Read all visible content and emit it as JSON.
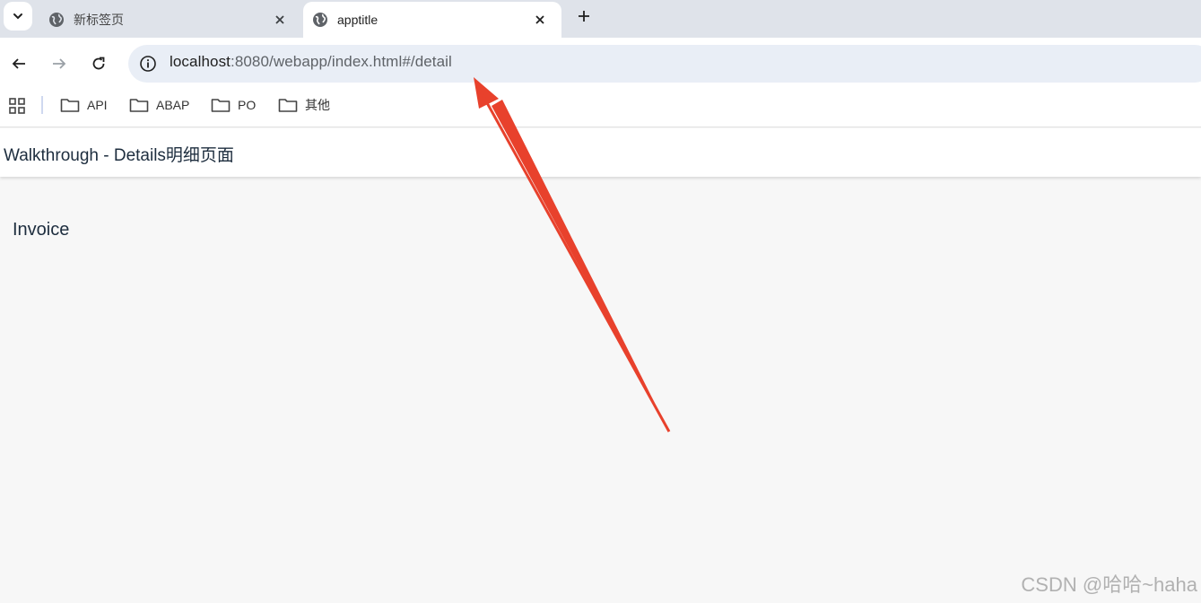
{
  "tabs": [
    {
      "title": "新标签页",
      "icon": "globe-icon",
      "active": false
    },
    {
      "title": "apptitle",
      "icon": "globe-icon",
      "active": true
    }
  ],
  "address_bar": {
    "host": "localhost",
    "path": ":8080/webapp/index.html#/detail"
  },
  "bookmarks": [
    {
      "label": "API",
      "icon": "folder-icon"
    },
    {
      "label": "ABAP",
      "icon": "folder-icon"
    },
    {
      "label": "PO",
      "icon": "folder-icon"
    },
    {
      "label": "其他",
      "icon": "folder-icon"
    }
  ],
  "app": {
    "title": "Walkthrough - Details明细页面",
    "content_text": "Invoice"
  },
  "annotation": {
    "type": "red-arrow",
    "color": "#e8412c",
    "points_to": "address_bar.path"
  },
  "watermark": "CSDN @哈哈~haha",
  "colors": {
    "tabstrip_bg": "#dfe3ea",
    "omnibox_bg": "#e9eef6",
    "page_bg": "#f7f7f7"
  }
}
